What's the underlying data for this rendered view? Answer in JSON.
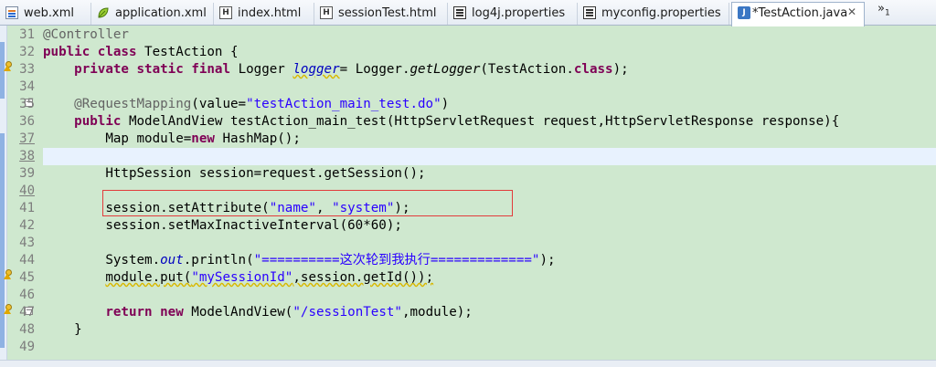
{
  "tabs": [
    {
      "label": "web.xml",
      "icon": "xml-file-icon"
    },
    {
      "label": "application.xml",
      "icon": "spring-leaf-icon"
    },
    {
      "label": "index.html",
      "icon": "html-file-icon"
    },
    {
      "label": "sessionTest.html",
      "icon": "html-file-icon"
    },
    {
      "label": "log4j.properties",
      "icon": "properties-file-icon"
    },
    {
      "label": "myconfig.properties",
      "icon": "properties-file-icon"
    },
    {
      "label": "*TestAction.java",
      "icon": "java-file-icon",
      "active": true
    }
  ],
  "overflow": {
    "glyph": "»",
    "count": "1"
  },
  "close_glyph": "✕",
  "line_numbers": [
    "31",
    "32",
    "33",
    "34",
    "35",
    "36",
    "37",
    "38",
    "39",
    "40",
    "41",
    "42",
    "43",
    "44",
    "45",
    "46",
    "47",
    "48",
    "49"
  ],
  "code": [
    [
      {
        "t": "@Controller",
        "c": "ann"
      }
    ],
    [
      {
        "t": "public",
        "c": "kw"
      },
      {
        "t": " "
      },
      {
        "t": "class",
        "c": "kw"
      },
      {
        "t": " TestAction {"
      }
    ],
    [
      {
        "t": "    "
      },
      {
        "t": "private",
        "c": "kw"
      },
      {
        "t": " "
      },
      {
        "t": "static",
        "c": "kw"
      },
      {
        "t": " "
      },
      {
        "t": "final",
        "c": "kw"
      },
      {
        "t": " Logger "
      },
      {
        "t": "logger",
        "c": "fld wv"
      },
      {
        "t": "= Logger."
      },
      {
        "t": "getLogger",
        "c": "it"
      },
      {
        "t": "(TestAction."
      },
      {
        "t": "class",
        "c": "kw"
      },
      {
        "t": ");"
      }
    ],
    [],
    [
      {
        "t": "    "
      },
      {
        "t": "@RequestMapping",
        "c": "ann"
      },
      {
        "t": "(value="
      },
      {
        "t": "\"testAction_main_test.do\"",
        "c": "str"
      },
      {
        "t": ")"
      }
    ],
    [
      {
        "t": "    "
      },
      {
        "t": "public",
        "c": "kw"
      },
      {
        "t": " ModelAndView testAction_main_test(HttpServletRequest request,HttpServletResponse response){"
      }
    ],
    [
      {
        "t": "        Map module="
      },
      {
        "t": "new",
        "c": "kw"
      },
      {
        "t": " HashMap();"
      }
    ],
    [],
    [
      {
        "t": "        HttpSession session=request.getSession();"
      }
    ],
    [],
    [
      {
        "t": "        session.setAttribute("
      },
      {
        "t": "\"name\"",
        "c": "str"
      },
      {
        "t": ", "
      },
      {
        "t": "\"system\"",
        "c": "str"
      },
      {
        "t": ");"
      }
    ],
    [
      {
        "t": "        session.setMaxInactiveInterval(60*60);"
      }
    ],
    [],
    [
      {
        "t": "        System."
      },
      {
        "t": "out",
        "c": "fld"
      },
      {
        "t": ".println("
      },
      {
        "t": "\"==========这次轮到我执行=============\"",
        "c": "str"
      },
      {
        "t": ");"
      }
    ],
    [
      {
        "t": "        "
      },
      {
        "t": "module.put(",
        "c": "wv"
      },
      {
        "t": "\"mySessionId\"",
        "c": "str wv"
      },
      {
        "t": ",session.getId());",
        "c": "wv"
      }
    ],
    [],
    [
      {
        "t": "        "
      },
      {
        "t": "return",
        "c": "kw"
      },
      {
        "t": " "
      },
      {
        "t": "new",
        "c": "kw"
      },
      {
        "t": " ModelAndView("
      },
      {
        "t": "\"/sessionTest\"",
        "c": "str"
      },
      {
        "t": ",module);"
      }
    ],
    [
      {
        "t": "    }"
      }
    ],
    []
  ],
  "colors": {
    "editor_bg": "#cfe8cf",
    "current_line": "#e8f2fe",
    "keyword": "#7f0055",
    "string": "#2a00ff",
    "annotation": "#646464",
    "field": "#0000c0",
    "highlight_box": "#e23b3b"
  }
}
